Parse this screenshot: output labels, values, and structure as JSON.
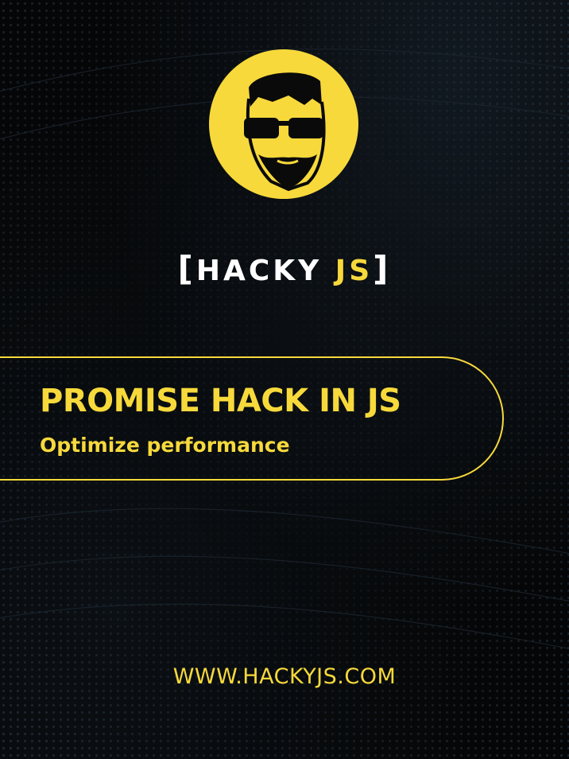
{
  "brand": {
    "open_bracket": "[",
    "name_part1": "HACKY ",
    "name_part2": "JS",
    "close_bracket": "]"
  },
  "banner": {
    "title": "PROMISE HACK IN JS",
    "subtitle": "Optimize performance"
  },
  "footer": {
    "website": "WWW.HACKYJS.COM"
  },
  "colors": {
    "accent": "#f7d93b",
    "background": "#050607",
    "text_light": "#ffffff"
  },
  "icons": {
    "avatar": "cartoon-face-sunglasses-icon"
  }
}
